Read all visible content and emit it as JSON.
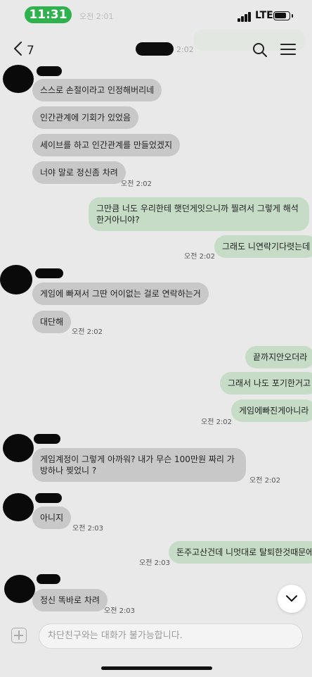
{
  "status": {
    "time": "11:31",
    "ghost_time": "오전 2:01",
    "network": "LTE"
  },
  "header": {
    "back_count": "7",
    "header_time": "2:02"
  },
  "messages": [
    {
      "text": "스스로 손절이라고 인정해버리네"
    },
    {
      "text": "인간관계에 기회가 있었음"
    },
    {
      "text": "세이브를 하고 인간관계를 만들었겠지"
    },
    {
      "text": "너야 말로 정신좀 차려",
      "time": "오전 2:02"
    },
    {
      "text": "그만큼 너도 우리한테 햇던게잇으니까 찔려서 그렇게 해석한거아니야?"
    },
    {
      "text": "그래도 니연락기다렷는데",
      "time": "오전 2:02"
    },
    {
      "text": "게임에 빠져서 그딴 어이없는 걸로 연락하는거"
    },
    {
      "text": "대단해",
      "time": "오전 2:02"
    },
    {
      "text": "끝까지안오더라"
    },
    {
      "text": "그래서 나도 포기한거고"
    },
    {
      "text": "게임에빠진게아니라",
      "time": "오전 2:02"
    },
    {
      "text": "게임계정이 그렇게 아까워? 내가 무슨 100만원 짜리 가방하나 찢었니 ?",
      "time": "오전 2:02"
    },
    {
      "text": "아니지",
      "time": "오전 2:03"
    },
    {
      "text": "돈주고산건데 니멋대로 탈퇴한것때문에",
      "time": "오전 2:03"
    },
    {
      "text": "정신 똑바로 차려",
      "time": "오전 2:03"
    }
  ],
  "composer": {
    "placeholder": "차단친구와는 대화가 불가능합니다."
  },
  "icons": {
    "back": "chevron-left-icon",
    "search": "search-icon",
    "menu": "hamburger-menu-icon",
    "scroll": "chevron-down-icon",
    "attach": "plus-icon"
  },
  "colors": {
    "background": "#e9e9e9",
    "incoming_bubble": "#c8c8c8",
    "outgoing_bubble": "#c7dcc7",
    "status_time_pill": "#2fb14e"
  }
}
